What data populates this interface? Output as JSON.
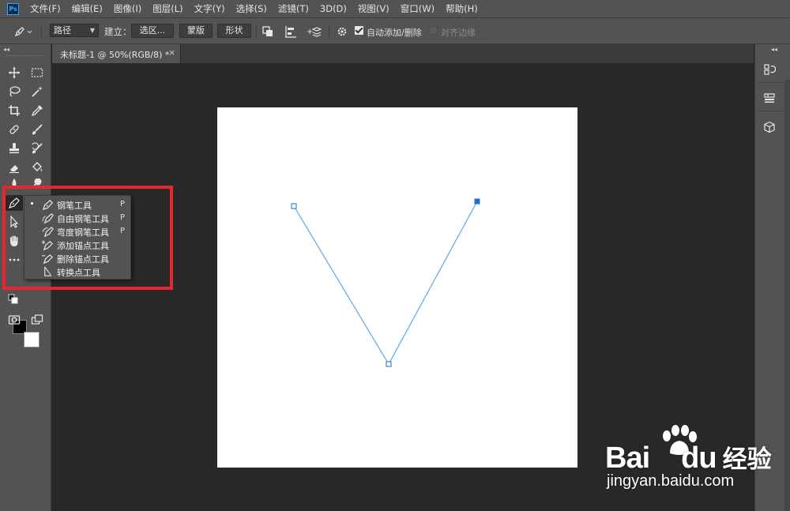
{
  "app": {
    "logo": "Ps"
  },
  "menubar": {
    "items": [
      "文件(F)",
      "编辑(E)",
      "图像(I)",
      "图层(L)",
      "文字(Y)",
      "选择(S)",
      "滤镜(T)",
      "3D(D)",
      "视图(V)",
      "窗口(W)",
      "帮助(H)"
    ]
  },
  "options": {
    "mode_value": "路径",
    "make_label": "建立：",
    "selection_button": "选区...",
    "mask_button": "蒙版",
    "shape_button": "形状",
    "auto_add_delete_label": "自动添加/删除",
    "auto_add_delete_checked": true,
    "align_edges_label": "对齐边缘",
    "align_edges_checked": false
  },
  "document": {
    "tab_title": "未标题-1 @ 50%(RGB/8) *",
    "close_glyph": "×"
  },
  "flyout": {
    "items": [
      {
        "label": "钢笔工具",
        "shortcut": "P",
        "icon": "pen-icon",
        "selected": true
      },
      {
        "label": "自由钢笔工具",
        "shortcut": "P",
        "icon": "freeform-pen-icon",
        "selected": false
      },
      {
        "label": "弯度钢笔工具",
        "shortcut": "P",
        "icon": "curvature-pen-icon",
        "selected": false
      },
      {
        "label": "添加锚点工具",
        "shortcut": "",
        "icon": "add-anchor-icon",
        "selected": false
      },
      {
        "label": "删除锚点工具",
        "shortcut": "",
        "icon": "delete-anchor-icon",
        "selected": false
      },
      {
        "label": "转换点工具",
        "shortcut": "",
        "icon": "convert-point-icon",
        "selected": false
      }
    ]
  },
  "colors": {
    "foreground": "#000000",
    "background": "#ffffff",
    "path_stroke": "#5aa8e8",
    "anchor_active": "#1f6fd0",
    "highlight_box": "#e8262b"
  },
  "watermark": {
    "brand": "Bai",
    "brand_tail": "du",
    "suffix": "经验",
    "url": "jingyan.baidu.com"
  }
}
